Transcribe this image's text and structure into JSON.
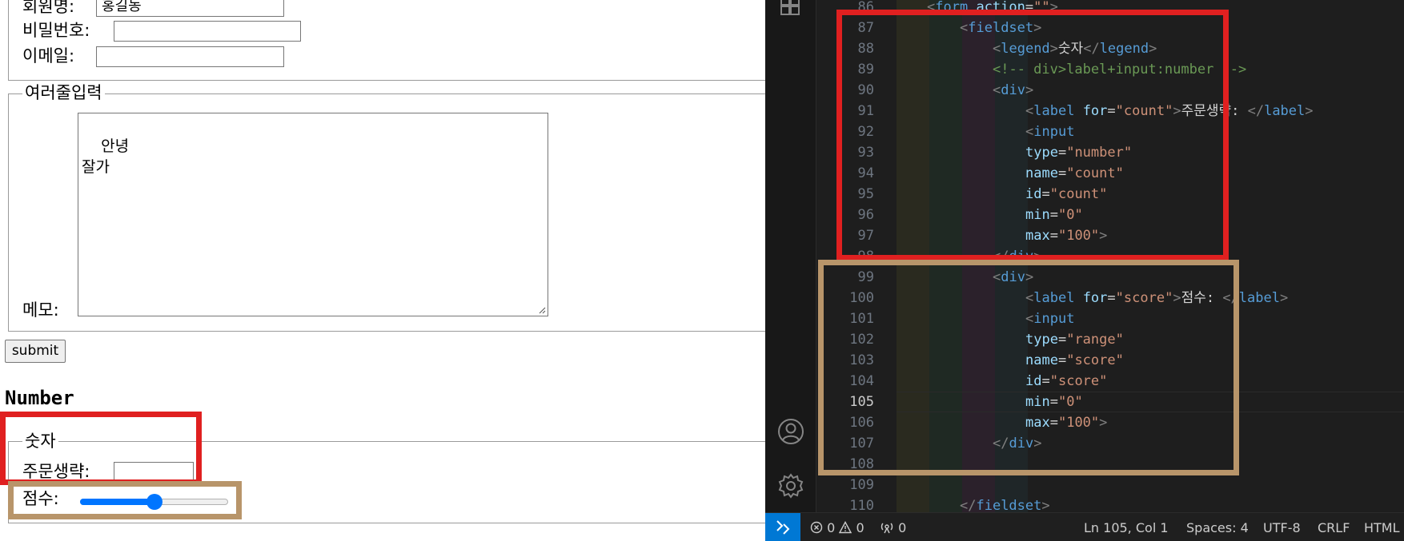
{
  "browser": {
    "member_form": {
      "name_label": "회원명:",
      "name_value": "홍길동",
      "password_label": "비밀번호:",
      "email_label": "이메일:"
    },
    "multiline": {
      "legend": "여러줄입력",
      "memo_label": "메모:",
      "memo_value": "안녕\n잘가"
    },
    "submit_label": "submit",
    "section_title": "Number",
    "number_fieldset": {
      "legend": "숫자",
      "count_label": "주문생략:",
      "score_label": "점수:",
      "score_value": 50,
      "score_min": 0,
      "score_max": 100
    },
    "highlight_colors": {
      "red": "#e02020",
      "tan": "#b8956a"
    }
  },
  "editor": {
    "active_line": 105,
    "line_numbers": [
      86,
      87,
      88,
      89,
      90,
      91,
      92,
      93,
      94,
      95,
      96,
      97,
      98,
      99,
      100,
      101,
      102,
      103,
      104,
      105,
      106,
      107,
      108,
      109,
      110
    ],
    "code_lines": [
      [
        {
          "t": "punc",
          "v": "<"
        },
        {
          "t": "tag",
          "v": "form"
        },
        {
          "t": "txt",
          "v": " "
        },
        {
          "t": "attr",
          "v": "action"
        },
        {
          "t": "txt",
          "v": "="
        },
        {
          "t": "str",
          "v": "\"\""
        },
        {
          "t": "punc",
          "v": ">"
        }
      ],
      [
        {
          "t": "punc",
          "v": "<"
        },
        {
          "t": "tag",
          "v": "fieldset"
        },
        {
          "t": "punc",
          "v": ">"
        }
      ],
      [
        {
          "t": "punc",
          "v": "<"
        },
        {
          "t": "tag",
          "v": "legend"
        },
        {
          "t": "punc",
          "v": ">"
        },
        {
          "t": "txt",
          "v": "숫자"
        },
        {
          "t": "punc",
          "v": "</"
        },
        {
          "t": "tag",
          "v": "legend"
        },
        {
          "t": "punc",
          "v": ">"
        }
      ],
      [
        {
          "t": "com",
          "v": "<!-- div>label+input:number -->"
        }
      ],
      [
        {
          "t": "punc",
          "v": "<"
        },
        {
          "t": "tag",
          "v": "div"
        },
        {
          "t": "punc",
          "v": ">"
        }
      ],
      [
        {
          "t": "punc",
          "v": "<"
        },
        {
          "t": "tag",
          "v": "label"
        },
        {
          "t": "txt",
          "v": " "
        },
        {
          "t": "attr",
          "v": "for"
        },
        {
          "t": "txt",
          "v": "="
        },
        {
          "t": "str",
          "v": "\"count\""
        },
        {
          "t": "punc",
          "v": ">"
        },
        {
          "t": "txt",
          "v": "주문생략: "
        },
        {
          "t": "punc",
          "v": "</"
        },
        {
          "t": "tag",
          "v": "label"
        },
        {
          "t": "punc",
          "v": ">"
        }
      ],
      [
        {
          "t": "punc",
          "v": "<"
        },
        {
          "t": "tag",
          "v": "input"
        }
      ],
      [
        {
          "t": "attr",
          "v": "type"
        },
        {
          "t": "txt",
          "v": "="
        },
        {
          "t": "str",
          "v": "\"number\""
        }
      ],
      [
        {
          "t": "attr",
          "v": "name"
        },
        {
          "t": "txt",
          "v": "="
        },
        {
          "t": "str",
          "v": "\"count\""
        }
      ],
      [
        {
          "t": "attr",
          "v": "id"
        },
        {
          "t": "txt",
          "v": "="
        },
        {
          "t": "str",
          "v": "\"count\""
        }
      ],
      [
        {
          "t": "attr",
          "v": "min"
        },
        {
          "t": "txt",
          "v": "="
        },
        {
          "t": "str",
          "v": "\"0\""
        }
      ],
      [
        {
          "t": "attr",
          "v": "max"
        },
        {
          "t": "txt",
          "v": "="
        },
        {
          "t": "str",
          "v": "\"100\""
        },
        {
          "t": "punc",
          "v": ">"
        }
      ],
      [
        {
          "t": "punc",
          "v": "</"
        },
        {
          "t": "tag",
          "v": "div"
        },
        {
          "t": "punc",
          "v": ">"
        }
      ],
      [
        {
          "t": "punc",
          "v": "<"
        },
        {
          "t": "tag",
          "v": "div"
        },
        {
          "t": "punc",
          "v": ">"
        }
      ],
      [
        {
          "t": "punc",
          "v": "<"
        },
        {
          "t": "tag",
          "v": "label"
        },
        {
          "t": "txt",
          "v": " "
        },
        {
          "t": "attr",
          "v": "for"
        },
        {
          "t": "txt",
          "v": "="
        },
        {
          "t": "str",
          "v": "\"score\""
        },
        {
          "t": "punc",
          "v": ">"
        },
        {
          "t": "txt",
          "v": "점수: "
        },
        {
          "t": "punc",
          "v": "</"
        },
        {
          "t": "tag",
          "v": "label"
        },
        {
          "t": "punc",
          "v": ">"
        }
      ],
      [
        {
          "t": "punc",
          "v": "<"
        },
        {
          "t": "tag",
          "v": "input"
        }
      ],
      [
        {
          "t": "attr",
          "v": "type"
        },
        {
          "t": "txt",
          "v": "="
        },
        {
          "t": "str",
          "v": "\"range\""
        }
      ],
      [
        {
          "t": "attr",
          "v": "name"
        },
        {
          "t": "txt",
          "v": "="
        },
        {
          "t": "str",
          "v": "\"score\""
        }
      ],
      [
        {
          "t": "attr",
          "v": "id"
        },
        {
          "t": "txt",
          "v": "="
        },
        {
          "t": "str",
          "v": "\"score\""
        }
      ],
      [
        {
          "t": "attr",
          "v": "min"
        },
        {
          "t": "txt",
          "v": "="
        },
        {
          "t": "str",
          "v": "\"0\""
        }
      ],
      [
        {
          "t": "attr",
          "v": "max"
        },
        {
          "t": "txt",
          "v": "="
        },
        {
          "t": "str",
          "v": "\"100\""
        },
        {
          "t": "punc",
          "v": ">"
        }
      ],
      [
        {
          "t": "punc",
          "v": "</"
        },
        {
          "t": "tag",
          "v": "div"
        },
        {
          "t": "punc",
          "v": ">"
        }
      ],
      [],
      [],
      [
        {
          "t": "punc",
          "v": "</"
        },
        {
          "t": "tag",
          "v": "fieldset"
        },
        {
          "t": "punc",
          "v": ">"
        }
      ]
    ],
    "highlight_colors": {
      "red": "#e02020",
      "tan": "#b8956a"
    }
  },
  "activity_icons": [
    "extensions-icon",
    "account-icon",
    "settings-gear-icon"
  ],
  "status_bar": {
    "remote_icon": "remote-icon",
    "errors": "0",
    "warnings": "0",
    "ports": "0",
    "cursor": "Ln 105, Col 1",
    "spaces": "Spaces: 4",
    "encoding": "UTF-8",
    "eol": "CRLF",
    "language": "HTML"
  }
}
